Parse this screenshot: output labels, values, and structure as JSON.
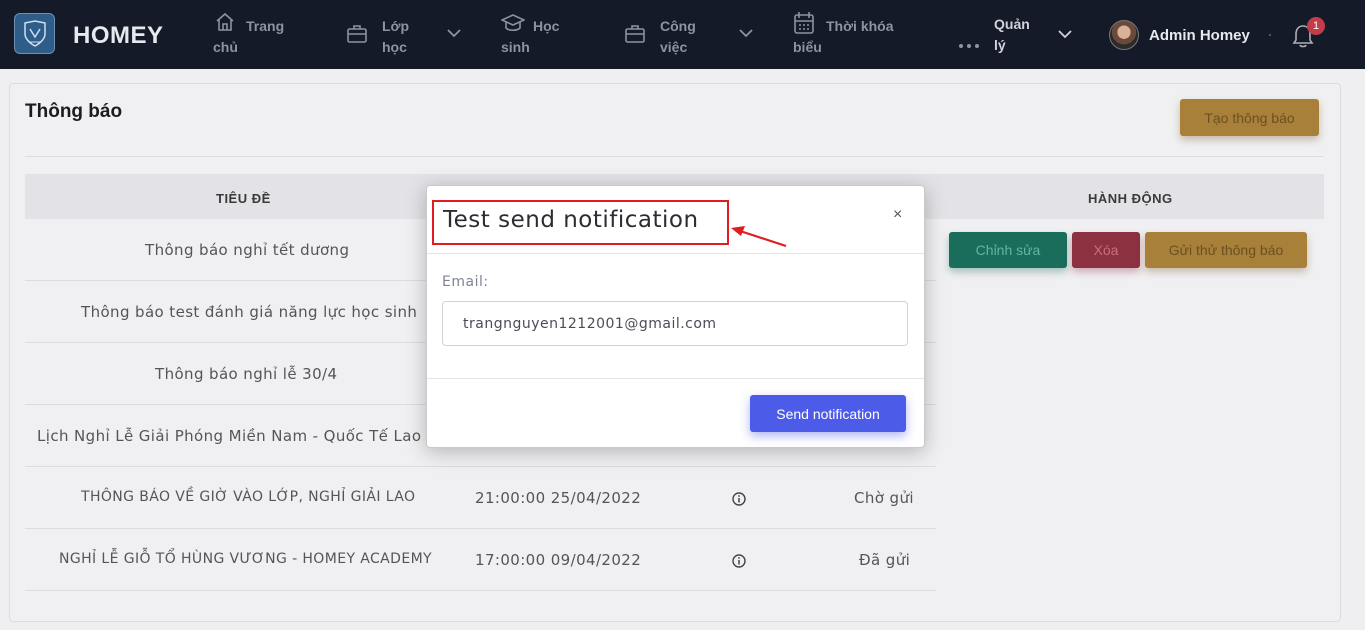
{
  "nav": {
    "brand": "HOMEY",
    "items": [
      {
        "line1": "Trang",
        "line2": "chủ",
        "icon": "home-icon"
      },
      {
        "line1": "Lớp",
        "line2": "học",
        "icon": "briefcase-icon"
      },
      {
        "line1": "Học",
        "line2": "sinh",
        "icon": "graduation-cap-icon"
      },
      {
        "line1": "Công",
        "line2": "việc",
        "icon": "briefcase-icon"
      },
      {
        "line1": "Thời khóa",
        "line2": "biểu",
        "icon": "calendar-icon"
      }
    ],
    "manage": {
      "line1": "Quản",
      "line2": "lý"
    },
    "user_name": "Admin Homey",
    "notification_count": "1"
  },
  "page": {
    "title": "Thông báo",
    "create_button": "Tạo thông báo"
  },
  "table": {
    "headers": {
      "title": "TIÊU ĐỀ",
      "actions": "HÀNH ĐỘNG"
    },
    "rows": [
      {
        "title": "Thông báo nghỉ tết dương",
        "time": "",
        "status": ""
      },
      {
        "title": "Thông báo test đánh giá năng lực học sinh",
        "time": "",
        "status": ""
      },
      {
        "title": "Thông báo nghỉ lễ 30/4",
        "time": "",
        "status": ""
      },
      {
        "title": "Lịch Nghỉ Lễ Giải Phóng Miền Nam - Quốc Tế Lao Độ",
        "time": "",
        "status": ""
      },
      {
        "title": "THÔNG BÁO VỀ GIỜ VÀO LỚP, NGHỈ GIẢI LAO",
        "time": "21:00:00 25/04/2022",
        "status": "Chờ gửi"
      },
      {
        "title": "NGHỈ LỄ GIỖ TỔ HÙNG VƯƠNG - HOMEY ACADEMY",
        "time": "17:00:00 09/04/2022",
        "status": "Đã gửi"
      }
    ],
    "actions": {
      "edit": "Chỉnh sửa",
      "delete": "Xóa",
      "test_send": "Gửi thử thông báo"
    }
  },
  "modal": {
    "title": "Test send notification",
    "close": "×",
    "email_label": "Email:",
    "email_value": "trangnguyen1212001@gmail.com",
    "send_button": "Send notification"
  },
  "colors": {
    "nav_bg": "#141a27",
    "highlight_box": "#e01b22",
    "primary": "#4d5ce8",
    "warning": "#a8803a",
    "success": "#1a6d5b",
    "danger": "#8c3140"
  }
}
